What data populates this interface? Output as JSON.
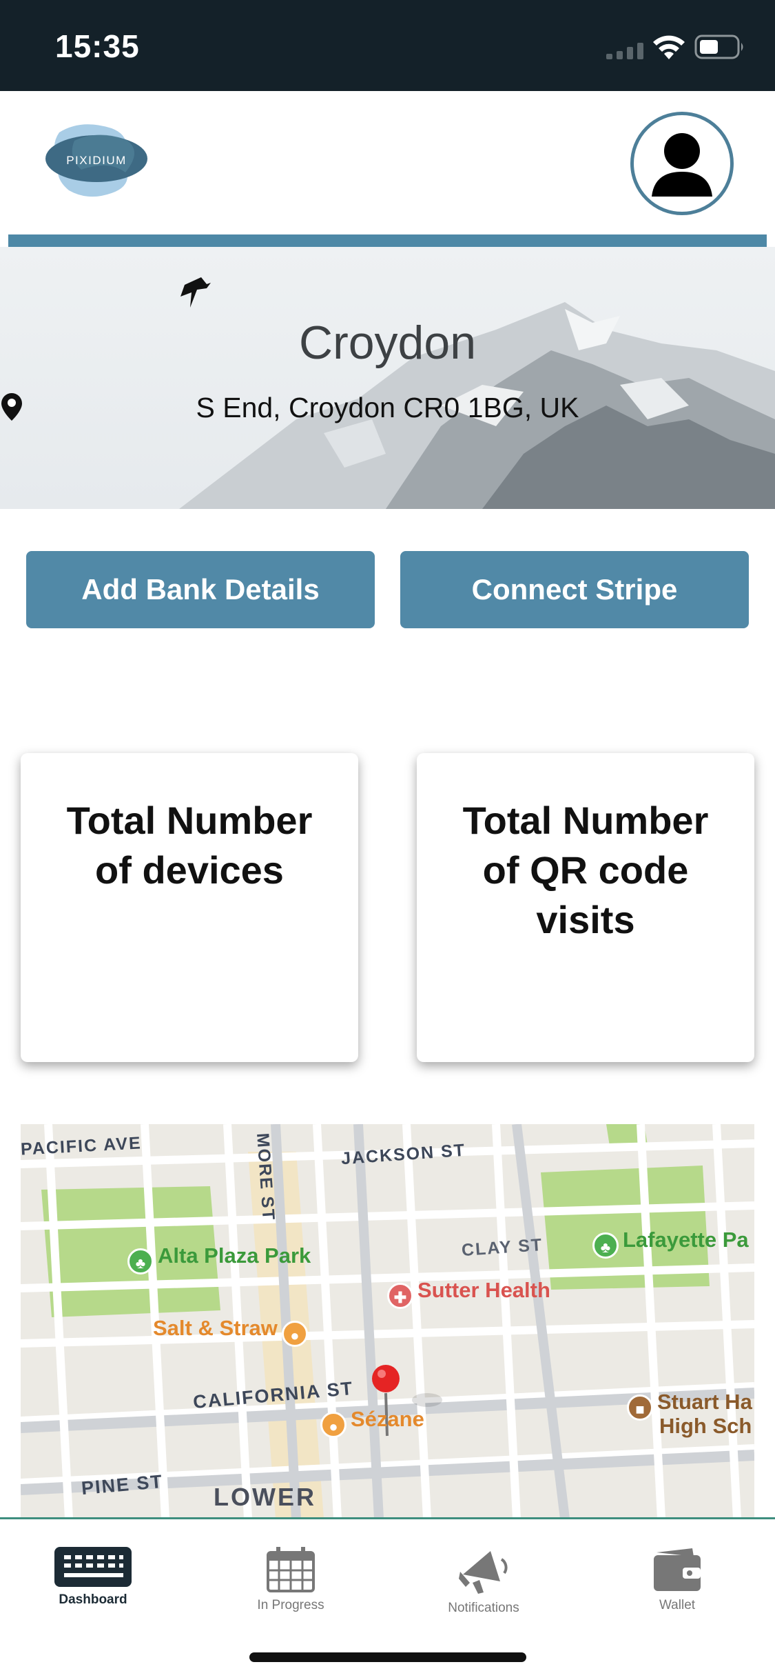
{
  "status_bar": {
    "time": "15:35",
    "icons": [
      "cellular-signal-icon",
      "wifi-icon",
      "battery-icon"
    ]
  },
  "header": {
    "logo_text": "PIXIDIUM",
    "profile_icon": "user-avatar-icon"
  },
  "hero": {
    "title": "Croydon",
    "address": "S End, Croydon CR0 1BG, UK",
    "address_icon": "map-pin-icon"
  },
  "actions": {
    "add_bank_details": "Add Bank Details",
    "connect_stripe": "Connect Stripe"
  },
  "stats": {
    "devices_title": "Total Number of devices",
    "qr_visits_title": "Total Number of QR code visits"
  },
  "map": {
    "streets": {
      "pacific_ave": "PACIFIC AVE",
      "jackson_st": "JACKSON ST",
      "fillmore_st": "MORE ST",
      "clay_st": "CLAY ST",
      "california_st": "CALIFORNIA ST",
      "pine_st": "PINE ST"
    },
    "district": "LOWER",
    "pois": {
      "alta_plaza_park": "Alta Plaza Park",
      "lafayette_park": "Lafayette Pa",
      "sutter_health": "Sutter Health",
      "salt_straw": "Salt & Straw",
      "sezane": "Sézane",
      "stuart_hall_1": "Stuart Ha",
      "stuart_hall_2": "High Sch"
    }
  },
  "tabs": [
    {
      "label": "Dashboard",
      "icon": "keyboard-icon",
      "active": true
    },
    {
      "label": "In Progress",
      "icon": "calendar-icon",
      "active": false
    },
    {
      "label": "Notifications",
      "icon": "megaphone-icon",
      "active": false
    },
    {
      "label": "Wallet",
      "icon": "wallet-icon",
      "active": false
    }
  ],
  "colors": {
    "status_bar_bg": "#142129",
    "accent": "#5189a7",
    "tab_border": "#3e8e7e"
  }
}
